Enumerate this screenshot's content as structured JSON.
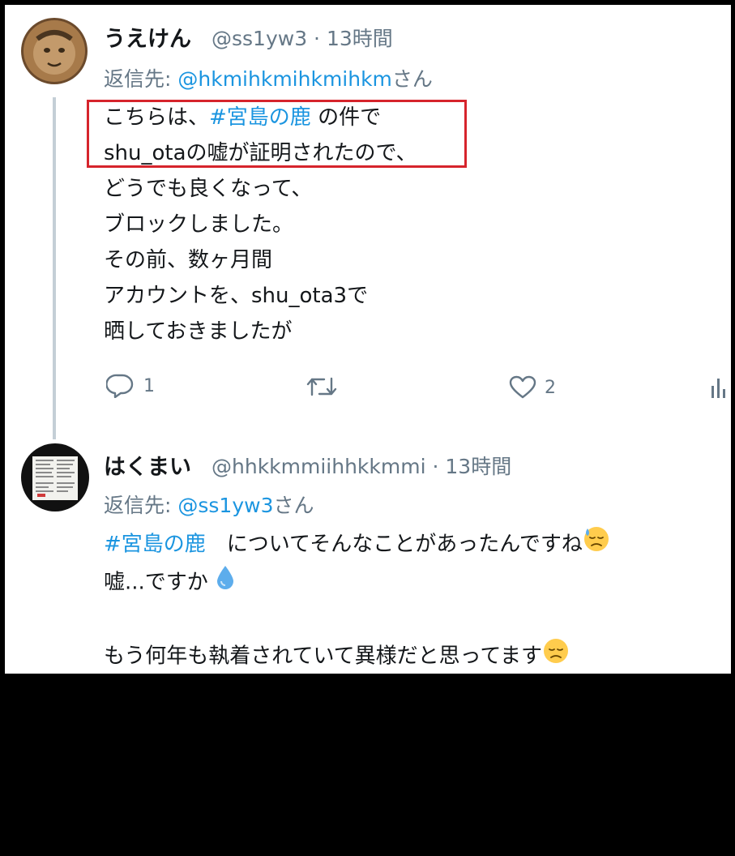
{
  "tweet1": {
    "name": "うえけん",
    "handle": "@ss1yw3 · 13時間",
    "reply_prefix": "返信先: ",
    "reply_to": "@hkmihkmihkmihkm",
    "reply_suffix": "さん",
    "lines": {
      "l1_pre": "こちらは、",
      "l1_hashtag": "#宮島の鹿",
      "l1_post": " の件で",
      "l2": "shu_otaの嘘が証明されたので、",
      "l3": "どうでも良くなって、",
      "l4": "ブロックしました。",
      "l5": "その前、数ヶ月間",
      "l6": "アカウントを、shu_ota3で",
      "l7": "晒しておきましたが"
    },
    "actions": {
      "reply_count": "1",
      "like_count": "2"
    }
  },
  "tweet2": {
    "name": "はくまい",
    "handle": "@hhkkmmiihhkkmmi · 13時間",
    "reply_prefix": "返信先: ",
    "reply_to": "@ss1yw3",
    "reply_suffix": "さん",
    "lines": {
      "l1_hashtag": "#宮島の鹿",
      "l1_post": "　についてそんなことがあったんですね",
      "l2": "嘘...ですか",
      "l4": "もう何年も執着されていて異様だと思ってます"
    }
  },
  "icons": {
    "reply": "speech-bubble-icon",
    "retweet": "retweet-arrows-icon",
    "like": "heart-icon",
    "analytics": "bar-chart-icon",
    "emoji_sweat": "sad-sweat-face-icon",
    "emoji_droplet": "droplet-icon",
    "emoji_disappointed": "disappointed-face-icon"
  },
  "colors": {
    "link": "#1b95e0",
    "text": "#14171a",
    "muted": "#657786",
    "highlight": "#d6242c"
  }
}
